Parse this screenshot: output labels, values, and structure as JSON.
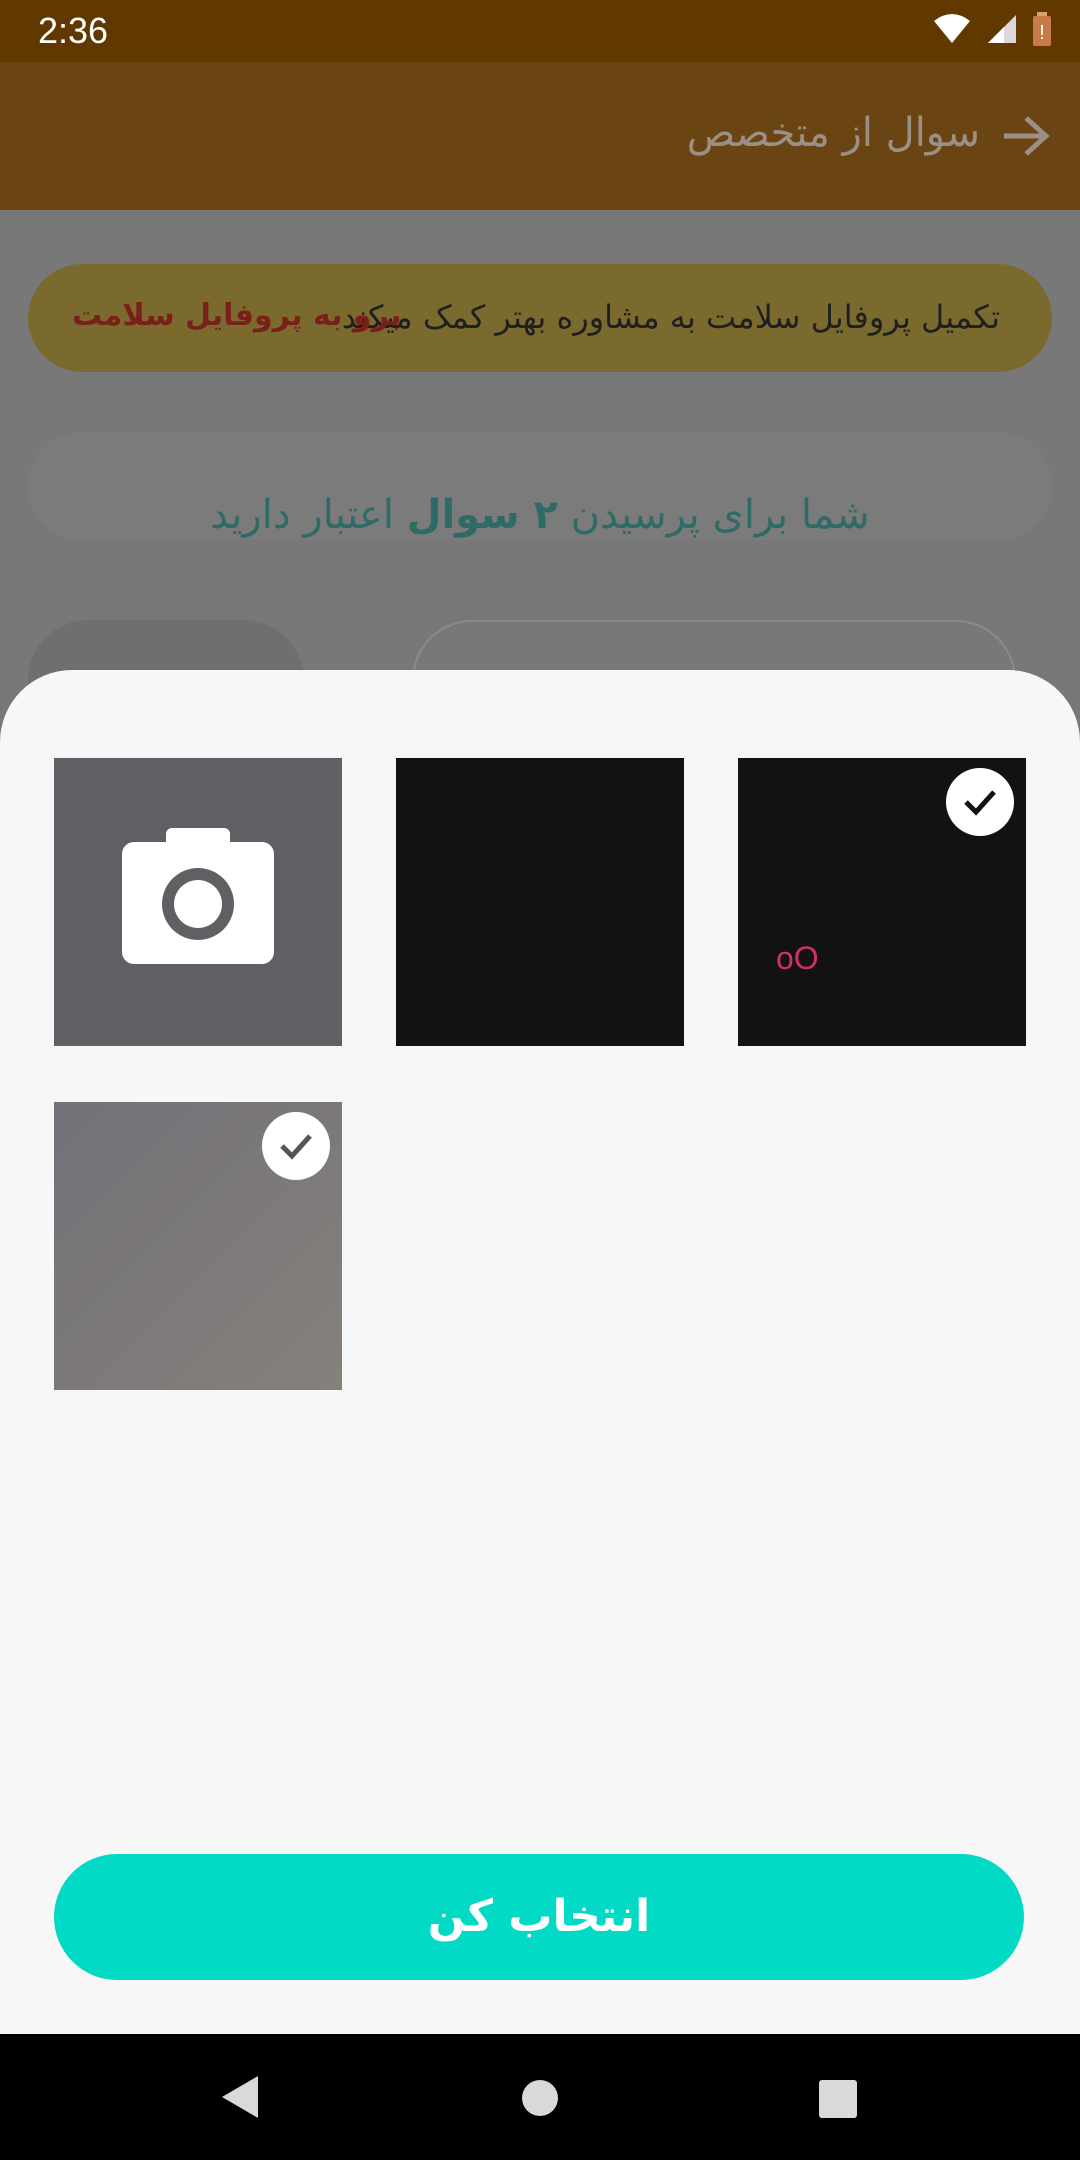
{
  "status_bar": {
    "time": "2:36"
  },
  "appbar": {
    "title": "سوال از متخصص"
  },
  "banner": {
    "text": "تکمیل پروفایل سلامت به مشاوره بهتر کمک میکند",
    "link": "برو به پروفایل سلامت"
  },
  "credit": {
    "prefix": "شما برای پرسیدن",
    "count": "۲ سوال",
    "suffix": "اعتبار دارید"
  },
  "gallery": {
    "tiles": [
      {
        "kind": "camera",
        "icon": "camera-icon",
        "selected": false
      },
      {
        "kind": "image",
        "selected": false
      },
      {
        "kind": "image",
        "selected": true,
        "overlay_text": "oO"
      },
      {
        "kind": "image",
        "selected": true
      }
    ]
  },
  "sheet": {
    "select_button": "انتخاب کن"
  },
  "colors": {
    "accent": "#02dac5",
    "status_bar": "#603800",
    "appbar": "#6a4412"
  }
}
